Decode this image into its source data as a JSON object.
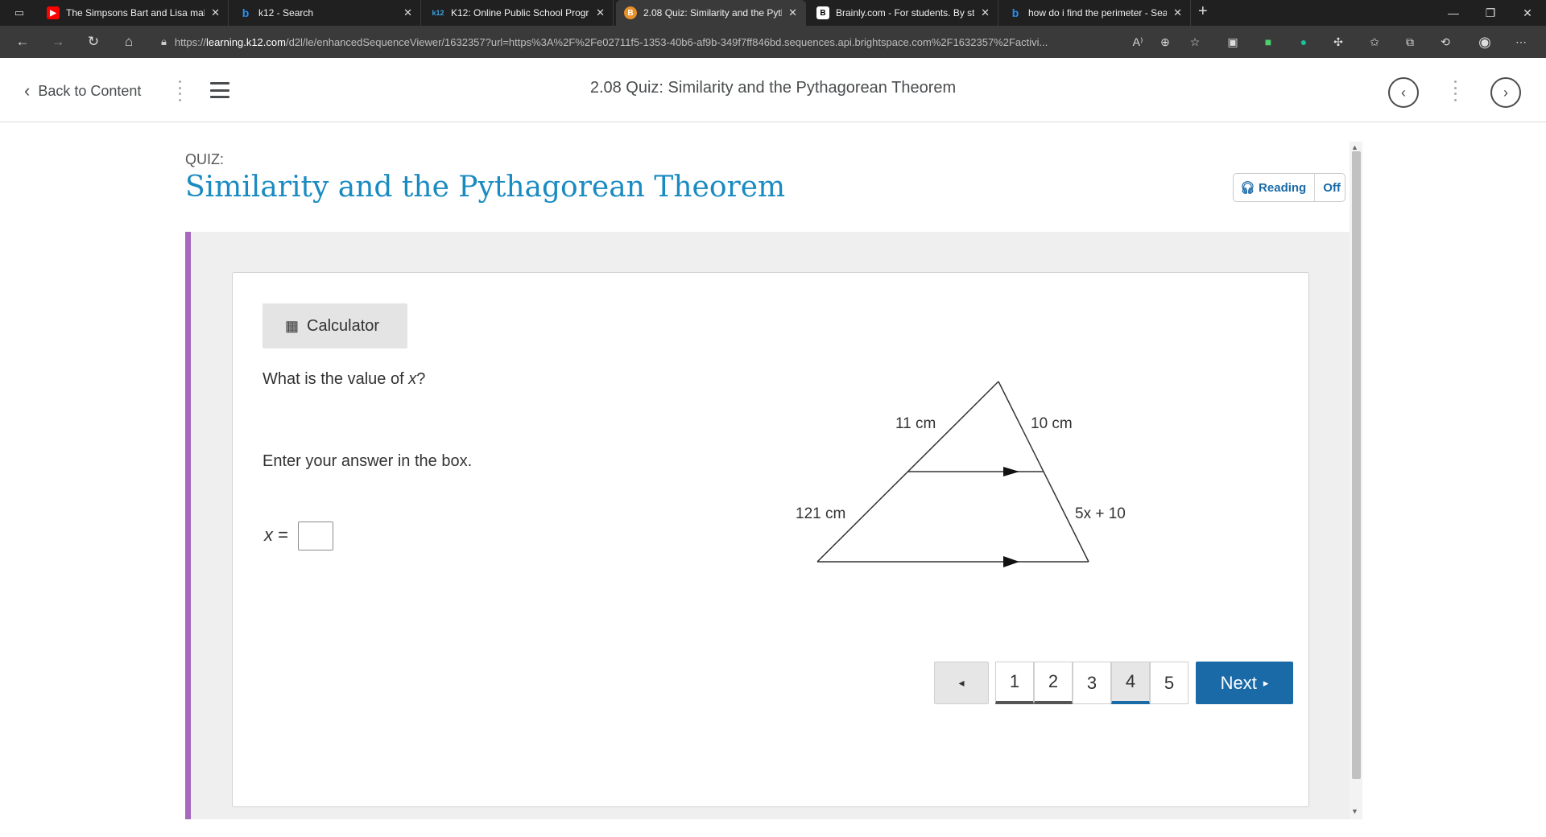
{
  "browser": {
    "tabs": [
      {
        "title": "The Simpsons Bart and Lisa mak",
        "favicon": "youtube-icon"
      },
      {
        "title": "k12 - Search",
        "favicon": "bing-icon"
      },
      {
        "title": "K12: Online Public School Progra",
        "favicon": "k12-icon"
      },
      {
        "title": "2.08 Quiz: Similarity and the Pyth",
        "favicon": "brightspace-icon"
      },
      {
        "title": "Brainly.com - For students. By stu",
        "favicon": "brainly-icon"
      },
      {
        "title": "how do i find the perimeter - Sea",
        "favicon": "bing-icon"
      }
    ],
    "active_tab_index": 3,
    "url_prefix": "https://",
    "url_host": "learning.k12.com",
    "url_rest": "/d2l/le/enhancedSequenceViewer/1632357?url=https%3A%2F%2Fe02711f5-1353-40b6-af9b-349f7ff846bd.sequences.api.brightspace.com%2F1632357%2Factivi..."
  },
  "header": {
    "back_label": "Back to Content",
    "title": "2.08 Quiz: Similarity and the Pythagorean Theorem"
  },
  "quiz": {
    "label": "QUIZ:",
    "title": "Similarity and the Pythagorean Theorem",
    "reading_label": "Reading",
    "reading_state": "Off"
  },
  "question": {
    "calculator_label": "Calculator",
    "prompt_before": "What is the value of ",
    "prompt_var": "x",
    "prompt_after": "?",
    "instruction": "Enter your answer in the box.",
    "answer_var": "x",
    "answer_eq": " =",
    "answer_value": ""
  },
  "diagram": {
    "top_left": "11 cm",
    "top_right": "10 cm",
    "bottom_left": "121 cm",
    "bottom_right": "5x + 10"
  },
  "pagination": {
    "prev_symbol": "◂",
    "pages": [
      "1",
      "2",
      "3",
      "4",
      "5"
    ],
    "answered": [
      1,
      2
    ],
    "current": 4,
    "next_label": "Next",
    "next_symbol": "▸"
  },
  "colors": {
    "accent_blue": "#1a6aa8",
    "title_blue": "#1a8bc1",
    "purple_bar": "#a768bf"
  }
}
